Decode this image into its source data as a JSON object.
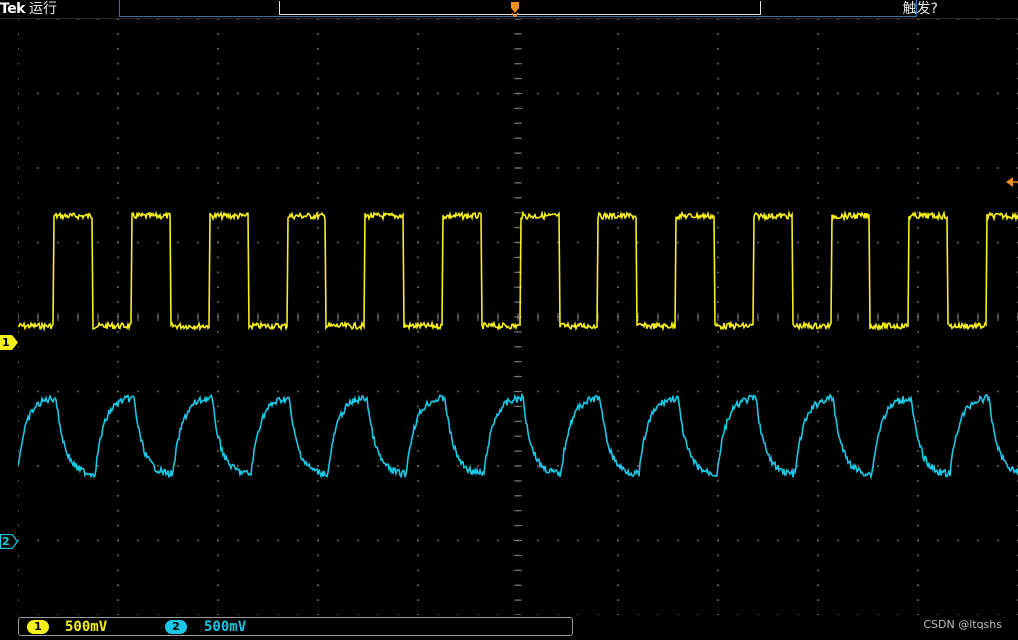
{
  "header": {
    "brand": "Tek",
    "acq_state": "运行",
    "trigger_status": "触发?"
  },
  "markers": {
    "trigger_position": "T"
  },
  "channels": [
    {
      "id": "1",
      "color": "#f5ef1a",
      "scale": "500mV"
    },
    {
      "id": "2",
      "color": "#1ac8e6",
      "scale": "500mV"
    }
  ],
  "watermark": "CSDN @ltqshs",
  "colors": {
    "background": "#000000",
    "grid": "#7a7a7a",
    "trigger": "#f08c1a",
    "record_bar": "#3c6fa8"
  }
}
